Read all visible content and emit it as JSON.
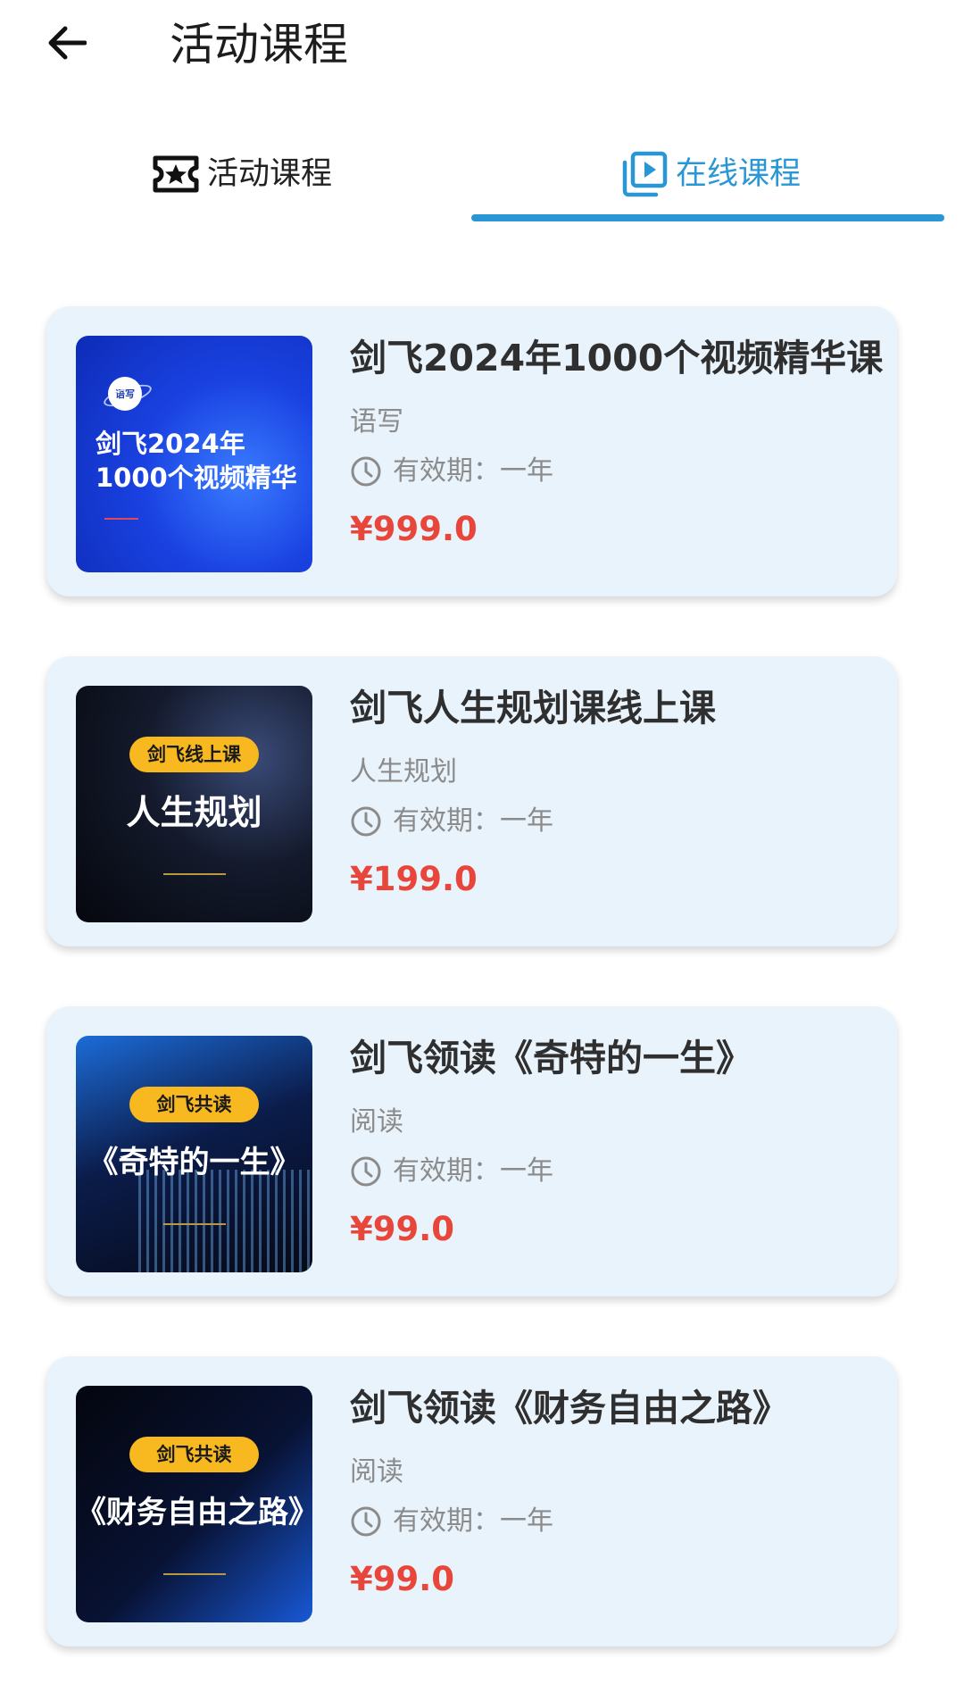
{
  "header": {
    "title": "活动课程"
  },
  "tabs": [
    {
      "label": "活动课程",
      "icon": "ticket-star-icon",
      "active": false
    },
    {
      "label": "在线课程",
      "icon": "video-playlist-icon",
      "active": true
    }
  ],
  "accent_color": "#2a97d5",
  "price_color": "#e8463a",
  "courses": [
    {
      "title": "剑飞2024年1000个视频精华课",
      "category": "语写",
      "validity": "有效期：一年",
      "price": "¥999.0",
      "cover": {
        "logo_text": "语写",
        "line1": "剑飞2024年",
        "line2": "1000个视频精华"
      }
    },
    {
      "title": "剑飞人生规划课线上课",
      "category": "人生规划",
      "validity": "有效期：一年",
      "price": "¥199.0",
      "cover": {
        "badge": "剑飞线上课",
        "main": "人生规划"
      }
    },
    {
      "title": "剑飞领读《奇特的一生》",
      "category": "阅读",
      "validity": "有效期：一年",
      "price": "¥99.0",
      "cover": {
        "badge": "剑飞共读",
        "main": "《奇特的一生》"
      }
    },
    {
      "title": "剑飞领读《财务自由之路》",
      "category": "阅读",
      "validity": "有效期：一年",
      "price": "¥99.0",
      "cover": {
        "badge": "剑飞共读",
        "main": "《财务自由之路》"
      }
    }
  ]
}
